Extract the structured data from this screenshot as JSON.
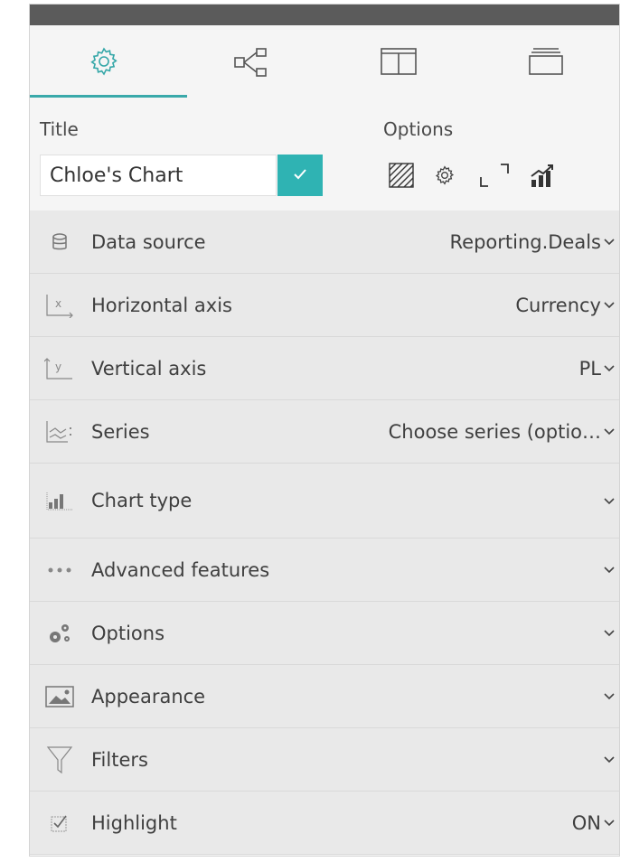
{
  "tabs": [
    {
      "name": "tab-settings",
      "icon": "gear-icon"
    },
    {
      "name": "tab-data-flow",
      "icon": "data-flow-icon"
    },
    {
      "name": "tab-layout",
      "icon": "split-layout-icon"
    },
    {
      "name": "tab-layers",
      "icon": "layers-icon"
    }
  ],
  "title_section": {
    "label": "Title",
    "value": "Chloe's Chart",
    "confirm_icon": "check-icon"
  },
  "options_section": {
    "label": "Options",
    "icons": [
      "hatch-pattern-icon",
      "gear-icon",
      "expand-corners-icon",
      "chart-trend-icon"
    ]
  },
  "rows": [
    {
      "label": "Data source",
      "value": "Reporting.Deals",
      "icon": "database-icon"
    },
    {
      "label": "Horizontal axis",
      "value": "Currency",
      "icon": "x-axis-icon"
    },
    {
      "label": "Vertical axis",
      "value": "PL",
      "icon": "y-axis-icon"
    },
    {
      "label": "Series",
      "value": "Choose series (optio…",
      "icon": "series-icon"
    },
    {
      "label": "Chart type",
      "value": "",
      "icon": "bar-chart-icon"
    },
    {
      "label": "Advanced features",
      "value": "",
      "icon": "ellipsis-icon"
    },
    {
      "label": "Options",
      "value": "",
      "icon": "gears-icon"
    },
    {
      "label": "Appearance",
      "value": "",
      "icon": "image-icon"
    },
    {
      "label": "Filters",
      "value": "",
      "icon": "filter-icon"
    },
    {
      "label": "Highlight",
      "value": "ON",
      "icon": "highlight-checkbox-icon"
    }
  ],
  "colors": {
    "accent": "#2fb3b3",
    "topbar": "#5b5b5b",
    "row_bg": "#e9e9e9"
  }
}
